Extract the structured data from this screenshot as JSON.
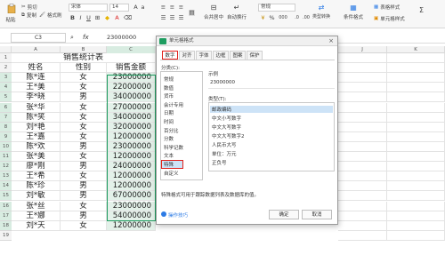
{
  "toolbar": {
    "paste": "粘贴",
    "format_painter": "格式刷",
    "cut": "剪切",
    "copy": "复制",
    "font_name": "宋体",
    "font_size": "14",
    "merge_center": "合并居中",
    "auto_wrap": "自动换行",
    "number_format": "常规",
    "conditional_format": "条件格式",
    "table_style": "表格样式",
    "cell_style": "单元格样式",
    "percent": "%",
    "thousands": "000"
  },
  "formula_bar": {
    "name_box": "C3",
    "fx": "fx",
    "value": "23000000"
  },
  "columns": [
    "A",
    "B",
    "C",
    "",
    "",
    "",
    "",
    "J",
    "K"
  ],
  "rows": [
    "1",
    "2",
    "3",
    "4",
    "5",
    "6",
    "7",
    "8",
    "9",
    "10",
    "11",
    "12",
    "13",
    "14",
    "15",
    "16",
    "17",
    "18",
    "19"
  ],
  "sheet": {
    "title": "销售统计表",
    "headers": [
      "姓名",
      "性别",
      "销售金额"
    ],
    "data": [
      [
        "陈*连",
        "女",
        "23000000"
      ],
      [
        "王*美",
        "女",
        "22000000"
      ],
      [
        "李*晓",
        "男",
        "34000000"
      ],
      [
        "张*华",
        "女",
        "27000000"
      ],
      [
        "陈*笑",
        "女",
        "34000000"
      ],
      [
        "刘*艳",
        "女",
        "32000000"
      ],
      [
        "王*嘉",
        "女",
        "12000000"
      ],
      [
        "陈*欢",
        "男",
        "23000000"
      ],
      [
        "张*美",
        "女",
        "12000000"
      ],
      [
        "廖*刚",
        "男",
        "24000000"
      ],
      [
        "王*希",
        "女",
        "12000000"
      ],
      [
        "陈*珍",
        "男",
        "12000000"
      ],
      [
        "刘*敏",
        "男",
        "67000000"
      ],
      [
        "张*丝",
        "女",
        "23000000"
      ],
      [
        "王*娜",
        "男",
        "54000000"
      ],
      [
        "刘*天",
        "女",
        "12000000"
      ]
    ]
  },
  "dialog": {
    "title": "单元格格式",
    "tabs": [
      "数字",
      "对齐",
      "字体",
      "边框",
      "图案",
      "保护"
    ],
    "category_label": "分类(C):",
    "categories": [
      "常规",
      "数值",
      "货币",
      "会计专用",
      "日期",
      "时间",
      "百分比",
      "分数",
      "科学记数",
      "文本",
      "特殊",
      "自定义"
    ],
    "selected_category": "特殊",
    "sample_label": "示例",
    "sample_value": "23000000",
    "type_label": "类型(T):",
    "types": [
      "邮政编码",
      "中文小写数字",
      "中文大写数字",
      "中文大写数字2",
      "人民币大写",
      "单位：万元",
      "正负号"
    ],
    "description": "特殊格式可用于跟踪数据列表及数据库的值。",
    "tips": "操作技巧",
    "ok": "确定",
    "cancel": "取消"
  },
  "colors": {
    "selection_green": "#1e9d60",
    "highlight_red": "#e0201b",
    "selected_list_blue": "#cde3f7"
  }
}
